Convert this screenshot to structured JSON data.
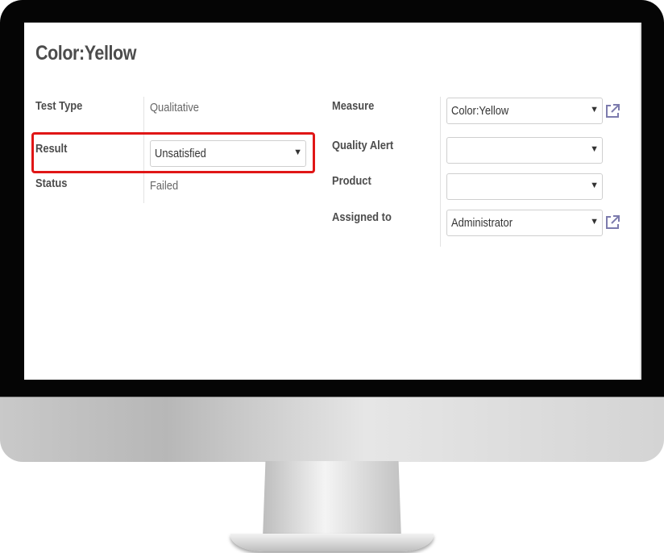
{
  "form": {
    "title": "Color:Yellow",
    "left_fields": {
      "test_type": {
        "label": "Test Type",
        "value": "Qualitative"
      },
      "result": {
        "label": "Result",
        "value": "Unsatisfied"
      },
      "status": {
        "label": "Status",
        "value": "Failed"
      }
    },
    "right_fields": {
      "measure": {
        "label": "Measure",
        "value": "Color:Yellow"
      },
      "quality_alert": {
        "label": "Quality Alert",
        "value": ""
      },
      "product": {
        "label": "Product",
        "value": ""
      },
      "assigned_to": {
        "label": "Assigned to",
        "value": "Administrator"
      }
    }
  },
  "icons": {
    "dropdown": "caret-down-icon",
    "external": "external-link-icon"
  },
  "colors": {
    "highlight": "#e01616",
    "link_icon": "#7c7bad",
    "bezel": "#050505"
  }
}
